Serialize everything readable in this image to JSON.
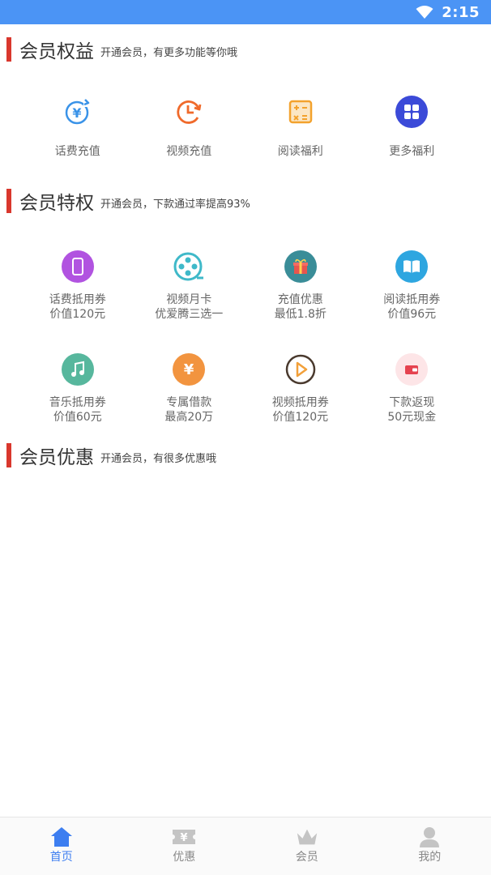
{
  "status_bar": {
    "time": "2:15",
    "color": "#4b94f5"
  },
  "sections": [
    {
      "title": "会员权益",
      "subtitle": "开通会员，有更多功能等你哦"
    },
    {
      "title": "会员特权",
      "subtitle": "开通会员，下款通过率提高93%"
    },
    {
      "title": "会员优惠",
      "subtitle": "开通会员，有很多优惠哦"
    }
  ],
  "benefits": [
    {
      "label": "话费充值",
      "icon": "yen-refresh-icon",
      "color": "#3a93e8"
    },
    {
      "label": "视频充值",
      "icon": "clock-refresh-icon",
      "color": "#f06a2b"
    },
    {
      "label": "阅读福利",
      "icon": "calculator-icon",
      "color": "#f3a22d"
    },
    {
      "label": "更多福利",
      "icon": "grid-icon",
      "color": "#3b4ad8"
    }
  ],
  "privileges": [
    {
      "line1": "话费抵用券",
      "line2": "价值120元",
      "icon": "phone-icon",
      "color": "#b153e0"
    },
    {
      "line1": "视频月卡",
      "line2": "优爱腾三选一",
      "icon": "film-reel-icon",
      "color": "#3fb9c9"
    },
    {
      "line1": "充值优惠",
      "line2": "最低1.8折",
      "icon": "gift-icon",
      "color": "#3a8d98"
    },
    {
      "line1": "阅读抵用券",
      "line2": "价值96元",
      "icon": "book-icon",
      "color": "#2ea6e0"
    },
    {
      "line1": "音乐抵用券",
      "line2": "价值60元",
      "icon": "music-note-icon",
      "color": "#57b79d"
    },
    {
      "line1": "专属借款",
      "line2": "最高20万",
      "icon": "yen-icon",
      "color": "#f2943f"
    },
    {
      "line1": "视频抵用券",
      "line2": "价值120元",
      "icon": "play-icon",
      "color": "#4a3a2e"
    },
    {
      "line1": "下款返现",
      "line2": "50元现金",
      "icon": "wallet-icon",
      "color": "#e5424f"
    }
  ],
  "bottom_nav": [
    {
      "label": "首页",
      "icon": "home-icon",
      "active": true
    },
    {
      "label": "优惠",
      "icon": "coupon-icon",
      "active": false
    },
    {
      "label": "会员",
      "icon": "crown-icon",
      "active": false
    },
    {
      "label": "我的",
      "icon": "user-icon",
      "active": false
    }
  ],
  "accent_color": "#d9372d",
  "active_nav_color": "#3d7ef0"
}
